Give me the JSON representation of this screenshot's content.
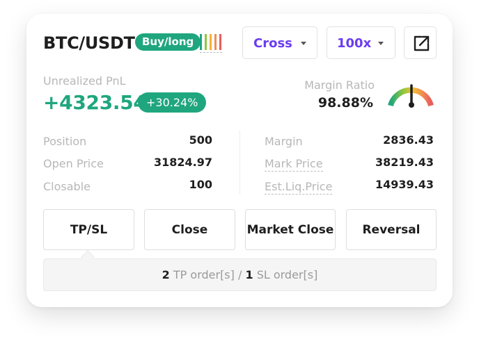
{
  "header": {
    "pair": "BTC/USDT",
    "side_badge": "Buy/long",
    "margin_mode": "Cross",
    "leverage": "100x",
    "signal_bar_colors": [
      "#1fa67e",
      "#8cc63f",
      "#f2b134",
      "#f28b52",
      "#e85c5c"
    ]
  },
  "pnl": {
    "label": "Unrealized PnL",
    "value": "+4323.54",
    "percent": "+30.24%"
  },
  "margin_ratio": {
    "label": "Margin Ratio",
    "value": "98.88%",
    "gauge_level_fraction": 0.5
  },
  "left_stats": [
    {
      "label": "Position",
      "value": "500"
    },
    {
      "label": "Open Price",
      "value": "31824.97"
    },
    {
      "label": "Closable",
      "value": "100"
    }
  ],
  "right_stats": [
    {
      "label": "Margin",
      "value": "2836.43"
    },
    {
      "label": "Mark Price",
      "value": "38219.43"
    },
    {
      "label": "Est.Liq.Price",
      "value": "14939.43"
    }
  ],
  "actions": {
    "tpsl": "TP/SL",
    "close": "Close",
    "market_close": "Market Close",
    "reversal": "Reversal"
  },
  "orders": {
    "tp_count": "2",
    "tp_text": "TP order[s] /",
    "sl_count": "1",
    "sl_text": "SL order[s]"
  },
  "colors": {
    "accent_green": "#1fa67e",
    "accent_purple": "#6b3cf0"
  }
}
